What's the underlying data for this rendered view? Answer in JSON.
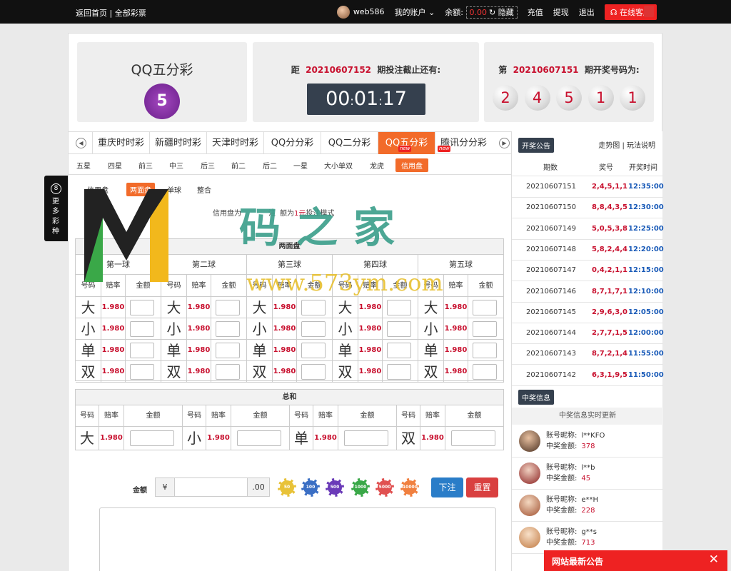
{
  "topbar": {
    "home": "返回首页",
    "all": "全部彩票",
    "username": "web586",
    "account": "我的账户",
    "balance_label": "余额:",
    "balance_value": "0.00",
    "hide": "隐藏",
    "deposit": "充值",
    "withdraw": "提现",
    "logout": "退出",
    "service": "在线客服"
  },
  "game": {
    "name": "QQ五分彩",
    "logo_text": "5",
    "countdown_prefix": "距",
    "countdown_period": "20210607152",
    "countdown_suffix": "期投注截止还有:",
    "clock_h": "00",
    "clock_m": "01",
    "clock_s": "17",
    "draw_prefix": "第",
    "draw_period": "20210607151",
    "draw_suffix": "期开奖号码为:",
    "balls": [
      "2",
      "4",
      "5",
      "1",
      "1"
    ]
  },
  "tabs": [
    "重庆时时彩",
    "新疆时时彩",
    "天津时时彩",
    "QQ分分彩",
    "QQ二分彩",
    "QQ五分彩",
    "腾讯分分彩"
  ],
  "new_badge": "new",
  "subtabs": [
    "五星",
    "四星",
    "前三",
    "中三",
    "后三",
    "前二",
    "后二",
    "一星",
    "大小单双",
    "龙虎",
    "信用盘"
  ],
  "modes": [
    "信用盘",
    "两面盘",
    "单球",
    "整合"
  ],
  "desc": {
    "a": "信用盘为",
    "b": "注",
    "c": "额为",
    "d": "1元",
    "e": "投注模式"
  },
  "grid": {
    "title": "两面盘",
    "balls": [
      "第一球",
      "第二球",
      "第三球",
      "第四球",
      "第五球"
    ],
    "col_code": "号码",
    "col_odds": "赔率",
    "col_amount": "金额",
    "codes": [
      "大",
      "小",
      "单",
      "双"
    ],
    "odds": "1.980"
  },
  "sum": {
    "title": "总和",
    "codes": [
      "大",
      "小",
      "单",
      "双"
    ],
    "odds": "1.980"
  },
  "bet": {
    "label": "金额",
    "currency": "¥",
    "decimal": ".00",
    "chips": [
      "50",
      "100",
      "500",
      "1000",
      "5000",
      "10000"
    ],
    "submit": "下注",
    "reset": "重置"
  },
  "side": {
    "notice_btn": "开奖公告",
    "links": "走势图 | 玩法说明",
    "cols": [
      "期数",
      "奖号",
      "开奖时间"
    ],
    "history": [
      {
        "p": "20210607151",
        "n": "2,4,5,1,1",
        "t": "12:35:00"
      },
      {
        "p": "20210607150",
        "n": "8,8,4,3,5",
        "t": "12:30:00"
      },
      {
        "p": "20210607149",
        "n": "5,0,5,3,8",
        "t": "12:25:00"
      },
      {
        "p": "20210607148",
        "n": "5,8,2,4,4",
        "t": "12:20:00"
      },
      {
        "p": "20210607147",
        "n": "0,4,2,1,1",
        "t": "12:15:00"
      },
      {
        "p": "20210607146",
        "n": "8,7,1,7,1",
        "t": "12:10:00"
      },
      {
        "p": "20210607145",
        "n": "2,9,6,3,0",
        "t": "12:05:00"
      },
      {
        "p": "20210607144",
        "n": "2,7,7,1,5",
        "t": "12:00:00"
      },
      {
        "p": "20210607143",
        "n": "8,7,2,1,4",
        "t": "11:55:00"
      },
      {
        "p": "20210607142",
        "n": "6,3,1,9,5",
        "t": "11:50:00"
      }
    ],
    "win_btn": "中奖信息",
    "win_title": "中奖信息实时更新",
    "nick_label": "账号昵称:",
    "amt_label": "中奖金额:",
    "winners": [
      {
        "nick": "l**KFO",
        "amt": "378"
      },
      {
        "nick": "l**b",
        "amt": "45"
      },
      {
        "nick": "e**H",
        "amt": "228"
      },
      {
        "nick": "g**s",
        "amt": "713"
      }
    ]
  },
  "more": {
    "num": "8",
    "label": "更多彩种"
  },
  "notice": {
    "title": "网站最新公告",
    "close": "✕"
  },
  "watermark": {
    "text": "码之家",
    "url": "www.573ym.com"
  }
}
